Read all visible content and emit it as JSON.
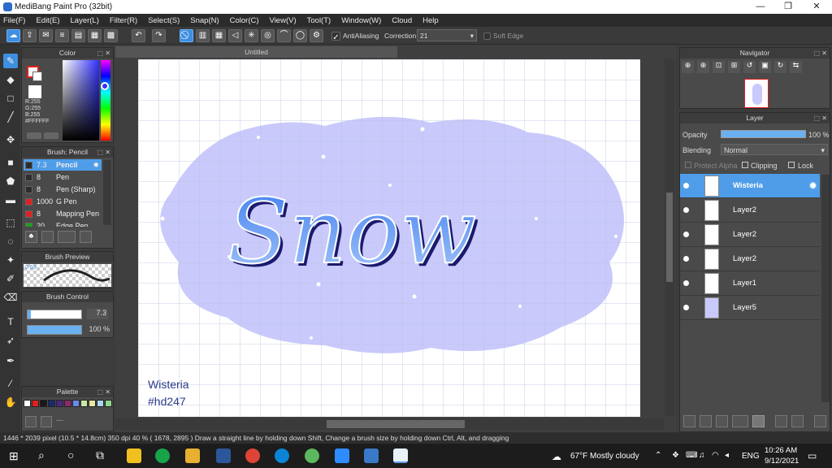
{
  "titlebar": {
    "title": "MediBang Paint Pro (32bit)",
    "min": "—",
    "max": "❐",
    "close": "✕"
  },
  "menu": [
    "File(F)",
    "Edit(E)",
    "Layer(L)",
    "Filter(R)",
    "Select(S)",
    "Snap(N)",
    "Color(C)",
    "View(V)",
    "Tool(T)",
    "Window(W)",
    "Cloud",
    "Help"
  ],
  "toolbar": {
    "antialiasing": "AntiAliasing",
    "correction_label": "Correction",
    "correction_value": "21",
    "soft_edge": "Soft Edge"
  },
  "color_panel": {
    "title": "Color",
    "r": "R:255",
    "g": "G:255",
    "b": "B:255",
    "hex": "#FFFFFF"
  },
  "brush_panel": {
    "title": "Brush: Pencil",
    "items": [
      {
        "size": "7.3",
        "name": "Pencil",
        "color": "#2c2c2c"
      },
      {
        "size": "8",
        "name": "Pen",
        "color": "#2c2c2c"
      },
      {
        "size": "8",
        "name": "Pen (Sharp)",
        "color": "#2c2c2c"
      },
      {
        "size": "1000",
        "name": "G Pen",
        "color": "#e02020"
      },
      {
        "size": "8",
        "name": "Mapping Pen",
        "color": "#e02020"
      },
      {
        "size": "20",
        "name": "Edge Pen",
        "color": "#20a020"
      }
    ]
  },
  "brush_preview": {
    "title": "Brush Preview",
    "size": "0.53"
  },
  "brush_control": {
    "title": "Brush Control",
    "size": "7.3",
    "opacity": "100 %",
    "size_fraction": 0.06,
    "opacity_fraction": 1.0
  },
  "palette": {
    "title": "Palette",
    "colors": [
      "#ffffff",
      "#e02020",
      "#181818",
      "#1a2a6e",
      "#4a2a7a",
      "#8a2a6a",
      "#6a8ae8",
      "#c8e8a8",
      "#e8e8a0",
      "#a8d8f0",
      "#90d890"
    ]
  },
  "canvas": {
    "tab": "Untitled",
    "artwork_text": "Snow",
    "signature_line1": "Wisteria",
    "signature_line2": "#hd247"
  },
  "navigator": {
    "title": "Navigator"
  },
  "layer_panel": {
    "title": "Layer",
    "opacity_label": "Opacity",
    "opacity_value": "100 %",
    "blending_label": "Blending",
    "blending_value": "Normal",
    "protect_alpha": "Protect Alpha",
    "clipping": "Clipping",
    "lock": "Lock",
    "layers": [
      {
        "name": "Wisteria",
        "selected": true
      },
      {
        "name": "Layer2"
      },
      {
        "name": "Layer2"
      },
      {
        "name": "Layer2"
      },
      {
        "name": "Layer1"
      },
      {
        "name": "Layer5"
      }
    ]
  },
  "status": {
    "text": "1446 * 2039 pixel  (10.5 * 14.8cm)  350 dpi  40 %  ( 1678, 2895 )  Draw a straight line by holding down Shift, Change a brush size by holding down Ctrl, Alt, and dragging"
  },
  "taskbar": {
    "weather": "67°F  Mostly cloudy",
    "lang": "ENG",
    "time": "10:26 AM",
    "date": "9/12/2021"
  }
}
